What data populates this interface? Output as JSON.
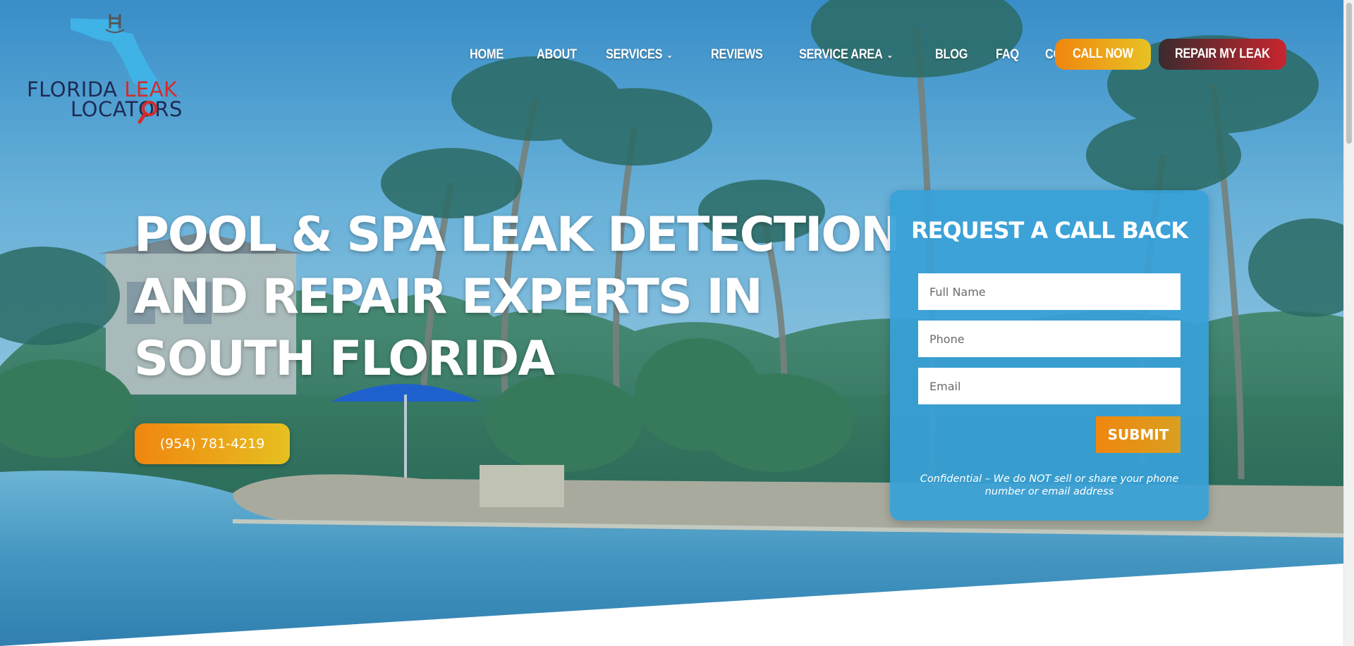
{
  "logo": {
    "line1_a": "FLORIDA ",
    "line1_b": "LEAK",
    "line2": "LOCATORS"
  },
  "nav": {
    "items": [
      {
        "label": "HOME",
        "dropdown": false
      },
      {
        "label": "ABOUT",
        "dropdown": false
      },
      {
        "label": "SERVICES",
        "dropdown": true
      },
      {
        "label": "REVIEWS",
        "dropdown": false
      },
      {
        "label": "SERVICE AREA",
        "dropdown": true
      },
      {
        "label": "BLOG",
        "dropdown": false
      },
      {
        "label": "FAQ",
        "dropdown": false
      },
      {
        "label": "CONTACT",
        "dropdown": false
      }
    ],
    "call_now": "CALL NOW",
    "repair": "REPAIR MY LEAK"
  },
  "hero": {
    "headline": [
      "POOL & SPA LEAK DETECTION",
      "AND REPAIR EXPERTS IN",
      "SOUTH FLORIDA"
    ],
    "phone": "(954) 781-4219"
  },
  "form": {
    "title": "REQUEST A CALL BACK",
    "name_placeholder": "Full Name",
    "phone_placeholder": "Phone",
    "email_placeholder": "Email",
    "submit": "SUBMIT",
    "disclaimer": "Confidential – We do NOT sell or share your phone number or email address"
  },
  "colors": {
    "accent_orange": "#f0860f",
    "accent_yellow": "#e8c224",
    "repair_red": "#c8252e",
    "form_blue": "#38a0d7",
    "logo_navy": "#1e2b55",
    "logo_red": "#d42b2b"
  }
}
